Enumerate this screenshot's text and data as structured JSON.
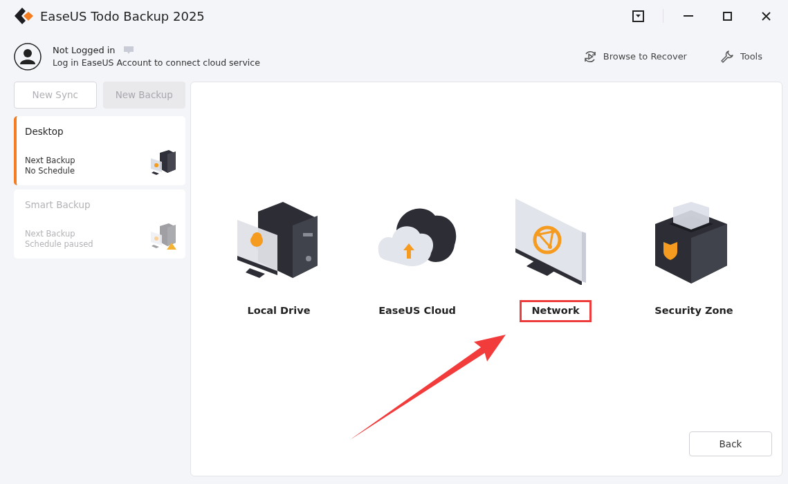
{
  "window": {
    "title": "EaseUS Todo Backup 2025"
  },
  "account": {
    "status": "Not Logged in",
    "message": "Log in EaseUS Account to connect cloud service"
  },
  "toolbar": [
    {
      "kind": "recover",
      "label": "Browse to Recover"
    },
    {
      "kind": "tools",
      "label": "Tools"
    }
  ],
  "sidebar": {
    "buttons": [
      {
        "label": "New Sync",
        "kind": "outline",
        "disabled": true
      },
      {
        "label": "New Backup",
        "kind": "filled",
        "disabled": true
      }
    ],
    "tasks": [
      {
        "name": "Desktop",
        "line_1": "Next Backup",
        "line_2": "No Schedule",
        "selected": true,
        "paused": false
      },
      {
        "name": "Smart Backup",
        "line_1": "Next Backup",
        "line_2": "Schedule paused",
        "selected": false,
        "paused": true
      }
    ]
  },
  "destinations": [
    {
      "kind": "local",
      "label": "Local Drive",
      "highlighted": false
    },
    {
      "kind": "cloud",
      "label": "EaseUS Cloud",
      "highlighted": false
    },
    {
      "kind": "network",
      "label": "Network",
      "highlighted": true
    },
    {
      "kind": "security",
      "label": "Security Zone",
      "highlighted": false
    }
  ],
  "back_button": {
    "label": "Back"
  }
}
